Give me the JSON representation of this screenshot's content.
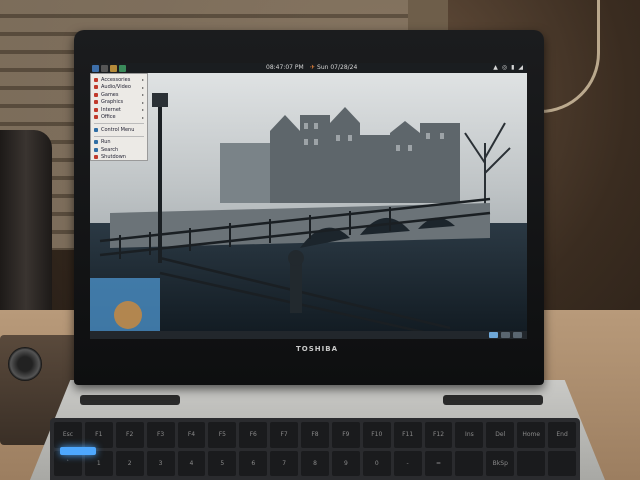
{
  "taskbar": {
    "clock": "08:47:07 PM",
    "date": "Sun 07/28/24"
  },
  "menu": {
    "items": [
      {
        "label": "Accessories",
        "has_submenu": true,
        "icon": "accessories-icon",
        "color": "#c0392b"
      },
      {
        "label": "Audio/Video",
        "has_submenu": true,
        "icon": "audio-video-icon",
        "color": "#c0392b"
      },
      {
        "label": "Games",
        "has_submenu": true,
        "icon": "games-icon",
        "color": "#c0392b"
      },
      {
        "label": "Graphics",
        "has_submenu": true,
        "icon": "graphics-icon",
        "color": "#c0392b"
      },
      {
        "label": "Internet",
        "has_submenu": true,
        "icon": "internet-icon",
        "color": "#c0392b"
      },
      {
        "label": "Office",
        "has_submenu": true,
        "icon": "office-icon",
        "color": "#c0392b"
      }
    ],
    "system_items": [
      {
        "label": "Control Menu",
        "icon": "control-menu-icon",
        "color": "#2e6da4"
      }
    ],
    "action_items": [
      {
        "label": "Run",
        "icon": "run-icon",
        "color": "#2e6da4"
      },
      {
        "label": "Search",
        "icon": "search-icon",
        "color": "#2e6da4"
      },
      {
        "label": "Shutdown",
        "icon": "shutdown-icon",
        "color": "#c0392b"
      }
    ]
  },
  "laptop": {
    "brand": "TOSHIBA"
  },
  "keyboard": {
    "keys": [
      "Esc",
      "F1",
      "F2",
      "F3",
      "F4",
      "F5",
      "F6",
      "F7",
      "F8",
      "F9",
      "F10",
      "F11",
      "F12",
      "Ins",
      "Del",
      "Home",
      "End",
      "`",
      "1",
      "2",
      "3",
      "4",
      "5",
      "6",
      "7",
      "8",
      "9",
      "0",
      "-",
      "=",
      "",
      "BkSp",
      "",
      ""
    ]
  },
  "colors": {
    "panel": "#1a1d20",
    "menu_bg": "#eceae6",
    "wallpaper_sky": "#dfe3e4",
    "wallpaper_water": "#1e2a33"
  }
}
